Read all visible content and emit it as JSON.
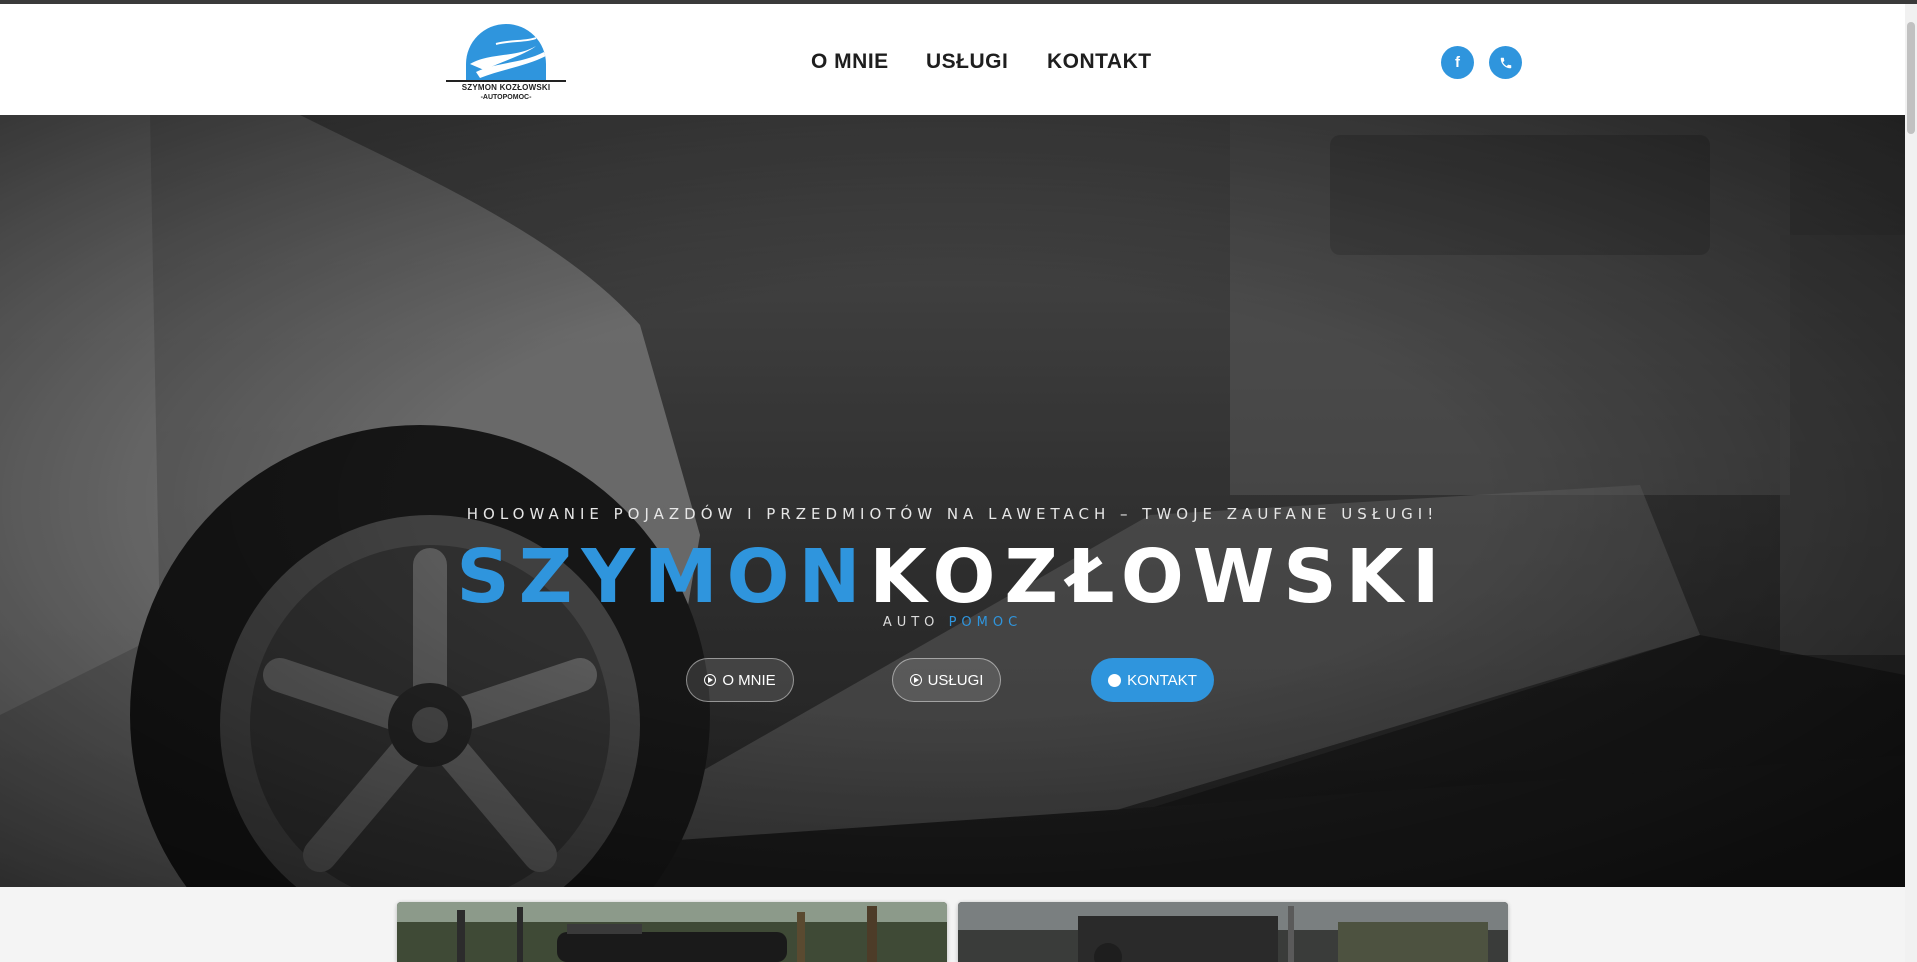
{
  "logo": {
    "name": "SZYMON KOZŁOWSKI",
    "sub": "-AUTOPOMOC-"
  },
  "nav": {
    "items": [
      {
        "label": "O MNIE"
      },
      {
        "label": "USŁUGI"
      },
      {
        "label": "KONTAKT"
      }
    ]
  },
  "social": {
    "facebook_icon": "facebook-icon",
    "phone_icon": "phone-icon"
  },
  "hero": {
    "kicker": "HOLOWANIE POJAZDÓW I PRZEDMIOTÓW NA LAWETACH – TWOJE ZAUFANE USŁUGI!",
    "title_first": "SZYMON",
    "title_last": "KOZŁOWSKI",
    "sub_first": "AUTO",
    "sub_second": "POMOC",
    "buttons": [
      {
        "label": "O MNIE",
        "icon": "play-circle-icon"
      },
      {
        "label": "USŁUGI",
        "icon": "play-circle-icon"
      },
      {
        "label": "KONTAKT",
        "icon": "circle-icon"
      }
    ]
  },
  "colors": {
    "accent": "#2f95dd",
    "nav_text": "#1e1e1e",
    "header_bg": "#ffffff"
  }
}
